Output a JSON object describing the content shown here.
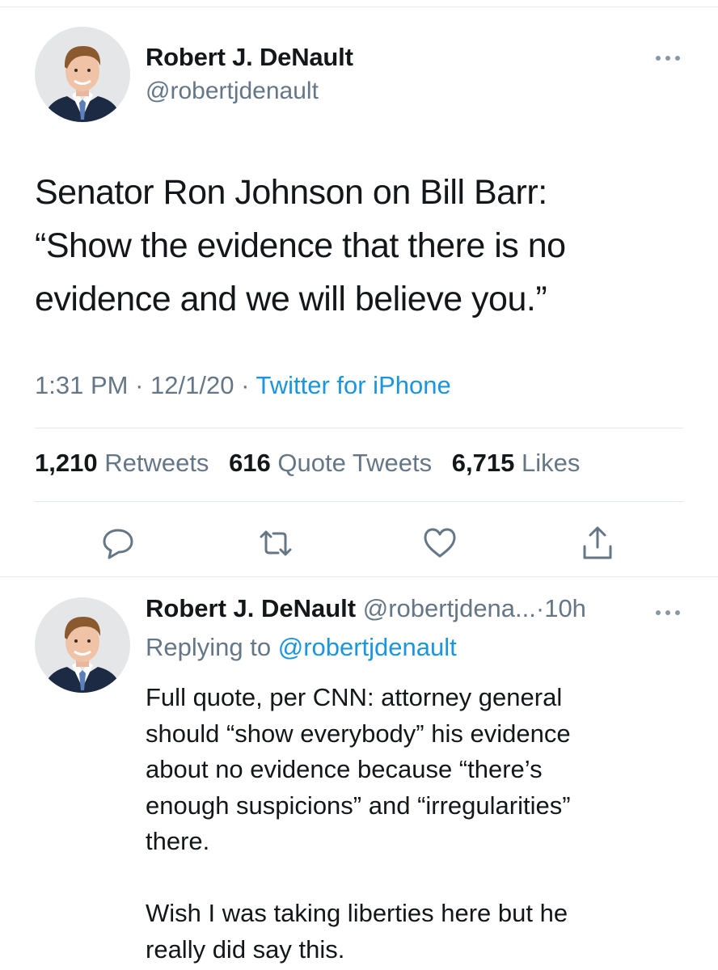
{
  "tweet": {
    "author_name": "Robert J. DeNault",
    "author_handle": "@robertjdenault",
    "more_icon": "more-dots-icon",
    "text_lines": [
      "Senator Ron Johnson on Bill Barr:",
      "“Show the evidence that there is no",
      "evidence and we will believe you.”"
    ],
    "time": "1:31 PM",
    "date": "12/1/20",
    "separator": "·",
    "source": "Twitter for iPhone",
    "stats": {
      "retweets_count": "1,210",
      "retweets_label": "Retweets",
      "quotes_count": "616",
      "quotes_label": "Quote Tweets",
      "likes_count": "6,715",
      "likes_label": "Likes"
    },
    "actions": [
      "reply-icon",
      "retweet-icon",
      "like-icon",
      "share-icon"
    ]
  },
  "reply": {
    "author_name": "Robert J. DeNault",
    "author_handle": "@robertjdena...",
    "separator": "·",
    "time": "10h",
    "replying_label": "Replying to",
    "replying_to": "@robertjdenault",
    "body_lines": [
      "Full quote, per CNN: attorney general",
      "should “show everybody” his evidence",
      "about no evidence because “there’s",
      "enough suspicions” and “irregularities”",
      "there.",
      "",
      "Wish I was taking liberties here but he",
      "really did say this."
    ]
  },
  "colors": {
    "text": "#14171a",
    "secondary": "#657786",
    "link": "#1b95e0",
    "divider": "#e1e8ed"
  }
}
